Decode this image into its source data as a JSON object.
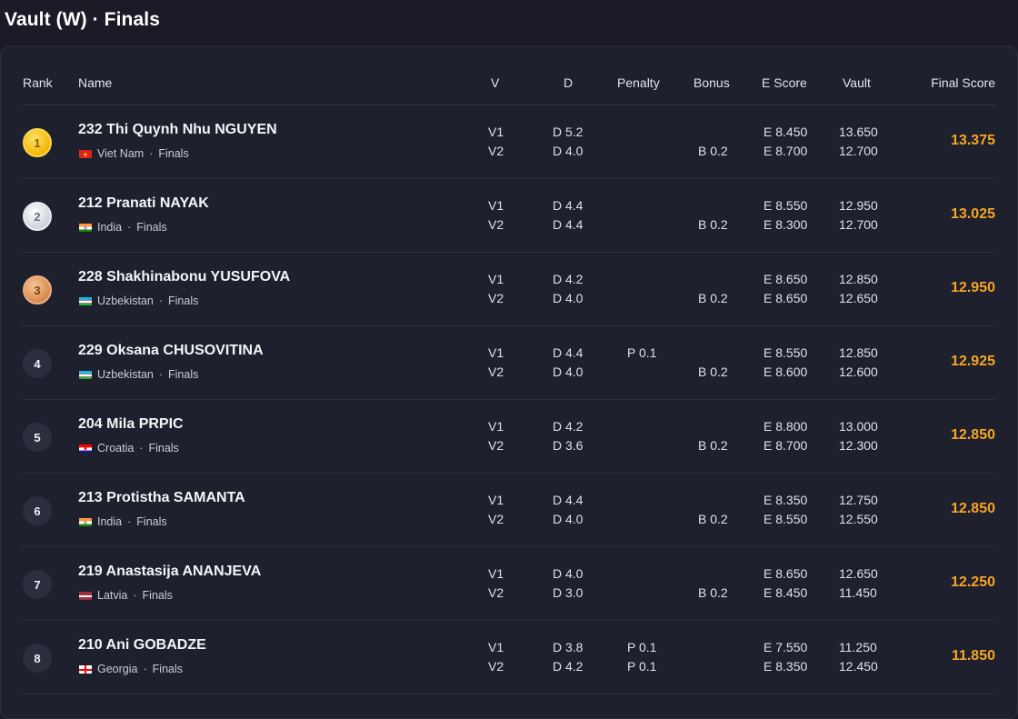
{
  "title": "Vault (W) · Finals",
  "columns": {
    "rank": "Rank",
    "name": "Name",
    "v": "V",
    "d": "D",
    "penalty": "Penalty",
    "bonus": "Bonus",
    "escore": "E Score",
    "vault": "Vault",
    "final": "Final Score"
  },
  "rows": [
    {
      "rank": "1",
      "medal": "gold",
      "name": "232 Thi Quynh Nhu NGUYEN",
      "country": "Viet Nam",
      "phase": "Finals",
      "flag": "vn",
      "v": [
        "V1",
        "V2"
      ],
      "d": [
        "D 5.2",
        "D 4.0"
      ],
      "penalty": [
        "",
        ""
      ],
      "bonus": [
        "",
        "B 0.2"
      ],
      "e": [
        "E 8.450",
        "E 8.700"
      ],
      "vault": [
        "13.650",
        "12.700"
      ],
      "final": "13.375"
    },
    {
      "rank": "2",
      "medal": "silver",
      "name": "212 Pranati NAYAK",
      "country": "India",
      "phase": "Finals",
      "flag": "in",
      "v": [
        "V1",
        "V2"
      ],
      "d": [
        "D 4.4",
        "D 4.4"
      ],
      "penalty": [
        "",
        ""
      ],
      "bonus": [
        "",
        "B 0.2"
      ],
      "e": [
        "E 8.550",
        "E 8.300"
      ],
      "vault": [
        "12.950",
        "12.700"
      ],
      "final": "13.025"
    },
    {
      "rank": "3",
      "medal": "bronze",
      "name": "228 Shakhinabonu YUSUFOVA",
      "country": "Uzbekistan",
      "phase": "Finals",
      "flag": "uz",
      "v": [
        "V1",
        "V2"
      ],
      "d": [
        "D 4.2",
        "D 4.0"
      ],
      "penalty": [
        "",
        ""
      ],
      "bonus": [
        "",
        "B 0.2"
      ],
      "e": [
        "E 8.650",
        "E 8.650"
      ],
      "vault": [
        "12.850",
        "12.650"
      ],
      "final": "12.950"
    },
    {
      "rank": "4",
      "medal": "plain",
      "name": "229 Oksana CHUSOVITINA",
      "country": "Uzbekistan",
      "phase": "Finals",
      "flag": "uz",
      "v": [
        "V1",
        "V2"
      ],
      "d": [
        "D 4.4",
        "D 4.0"
      ],
      "penalty": [
        "P 0.1",
        ""
      ],
      "bonus": [
        "",
        "B 0.2"
      ],
      "e": [
        "E 8.550",
        "E 8.600"
      ],
      "vault": [
        "12.850",
        "12.600"
      ],
      "final": "12.925"
    },
    {
      "rank": "5",
      "medal": "plain",
      "name": "204 Mila PRPIC",
      "country": "Croatia",
      "phase": "Finals",
      "flag": "hr",
      "v": [
        "V1",
        "V2"
      ],
      "d": [
        "D 4.2",
        "D 3.6"
      ],
      "penalty": [
        "",
        ""
      ],
      "bonus": [
        "",
        "B 0.2"
      ],
      "e": [
        "E 8.800",
        "E 8.700"
      ],
      "vault": [
        "13.000",
        "12.300"
      ],
      "final": "12.850"
    },
    {
      "rank": "6",
      "medal": "plain",
      "name": "213 Protistha SAMANTA",
      "country": "India",
      "phase": "Finals",
      "flag": "in",
      "v": [
        "V1",
        "V2"
      ],
      "d": [
        "D 4.4",
        "D 4.0"
      ],
      "penalty": [
        "",
        ""
      ],
      "bonus": [
        "",
        "B 0.2"
      ],
      "e": [
        "E 8.350",
        "E 8.550"
      ],
      "vault": [
        "12.750",
        "12.550"
      ],
      "final": "12.850"
    },
    {
      "rank": "7",
      "medal": "plain",
      "name": "219 Anastasija ANANJEVA",
      "country": "Latvia",
      "phase": "Finals",
      "flag": "lv",
      "v": [
        "V1",
        "V2"
      ],
      "d": [
        "D 4.0",
        "D 3.0"
      ],
      "penalty": [
        "",
        ""
      ],
      "bonus": [
        "",
        "B 0.2"
      ],
      "e": [
        "E 8.650",
        "E 8.450"
      ],
      "vault": [
        "12.650",
        "11.450"
      ],
      "final": "12.250"
    },
    {
      "rank": "8",
      "medal": "plain",
      "name": "210 Ani GOBADZE",
      "country": "Georgia",
      "phase": "Finals",
      "flag": "ge",
      "v": [
        "V1",
        "V2"
      ],
      "d": [
        "D 3.8",
        "D 4.2"
      ],
      "penalty": [
        "P 0.1",
        "P 0.1"
      ],
      "bonus": [
        "",
        ""
      ],
      "e": [
        "E 7.550",
        "E 8.350"
      ],
      "vault": [
        "11.250",
        "12.450"
      ],
      "final": "11.850"
    }
  ]
}
